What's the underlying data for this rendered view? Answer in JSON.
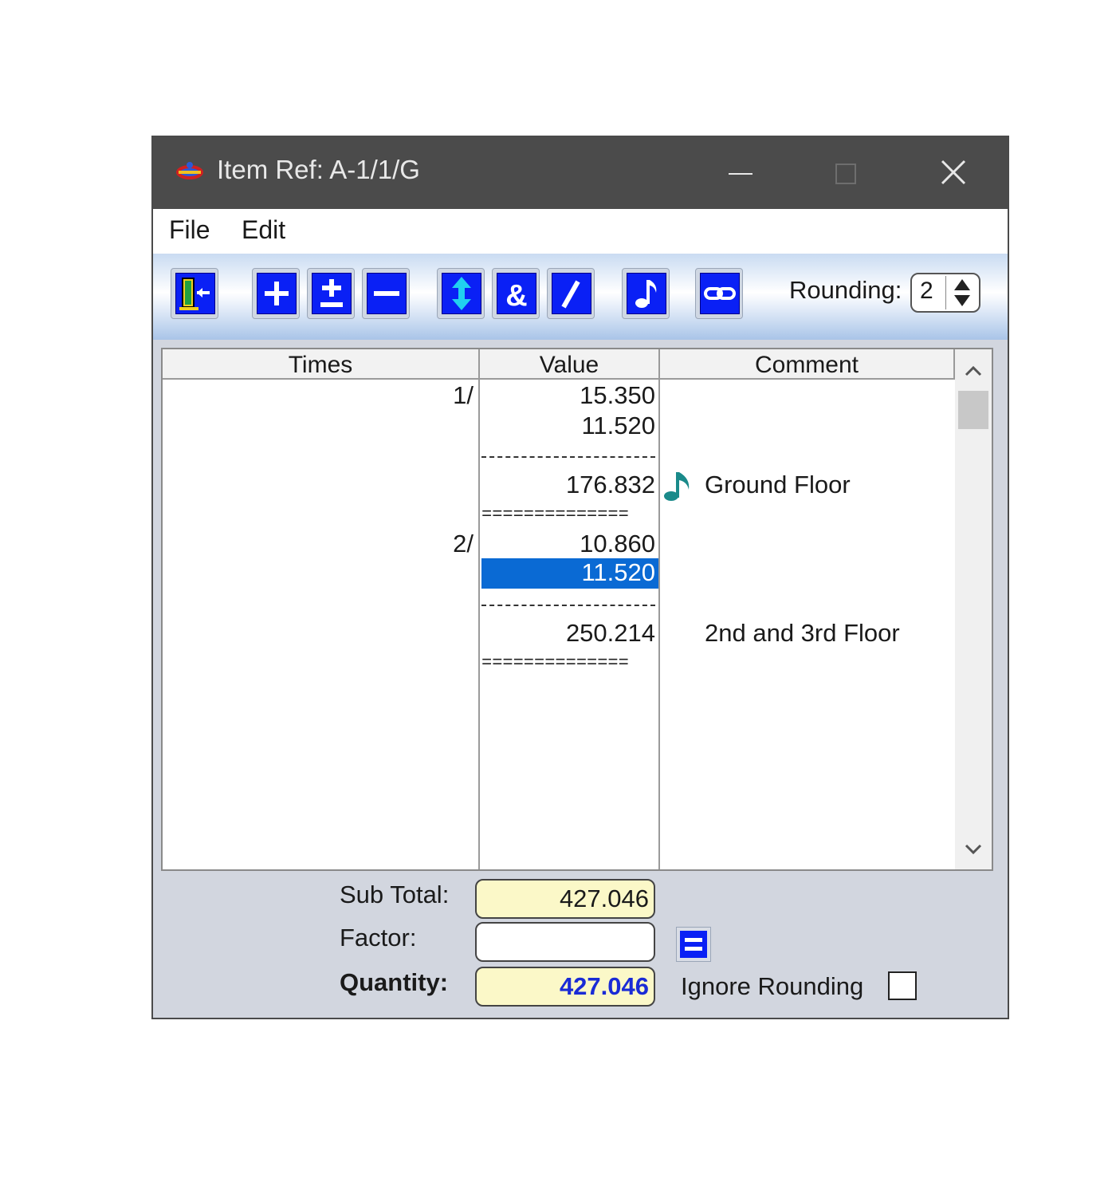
{
  "window": {
    "title": "Item Ref: A-1/1/G"
  },
  "menu": {
    "file": "File",
    "edit": "Edit"
  },
  "toolbar": {
    "rounding_label": "Rounding:",
    "rounding_value": "2",
    "buttons": [
      "exit-icon",
      "plus-icon",
      "plus-minus-icon",
      "minus-icon",
      "up-down-icon",
      "ampersand-icon",
      "slash-icon",
      "music-note-icon",
      "link-icon"
    ]
  },
  "grid": {
    "headers": {
      "times": "Times",
      "value": "Value",
      "comment": "Comment"
    },
    "rows": {
      "r1_times": "1/",
      "r1_value": "15.350",
      "r2_value": "11.520",
      "r3_value": "176.832",
      "r3_comment": "Ground Floor",
      "r4_times": "2/",
      "r4_value": "10.860",
      "r5_value": "11.520",
      "r6_value": "250.214",
      "r6_comment": "2nd and 3rd Floor"
    },
    "double_rule": "=============="
  },
  "footer": {
    "subtotal_label": "Sub Total:",
    "subtotal_value": "427.046",
    "factor_label": "Factor:",
    "factor_value": "",
    "quantity_label": "Quantity:",
    "quantity_value": "427.046",
    "ignore_rounding_label": "Ignore Rounding",
    "ignore_rounding_checked": false
  },
  "colors": {
    "button_blue": "#0a20f5",
    "selection_blue": "#0a6ad4",
    "field_yellow": "#fbf8c8",
    "quantity_text": "#1a2bd6",
    "note_teal": "#1a8a8a"
  }
}
